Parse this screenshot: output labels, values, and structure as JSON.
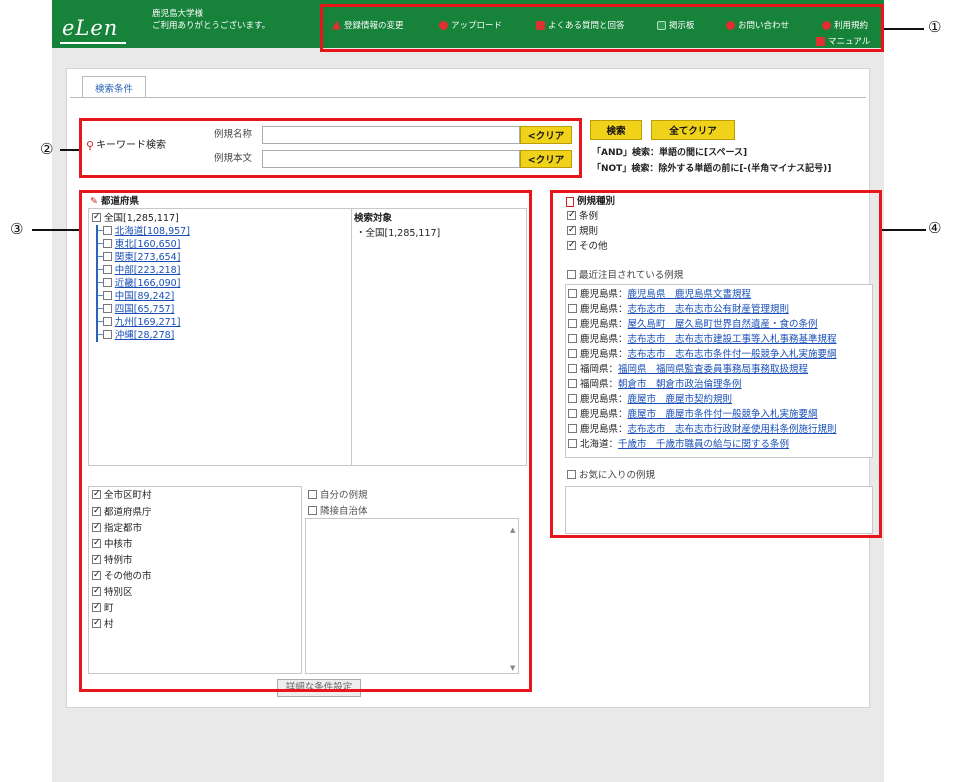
{
  "header": {
    "logo": "eLen",
    "greeting": "鹿児島大学様\nご利用ありがとうございます。",
    "nav": [
      {
        "label": "登録情報の変更",
        "icon": "warning-icon",
        "color": "#e03030"
      },
      {
        "label": "アップロード",
        "icon": "upload-icon",
        "color": "#e03030"
      },
      {
        "label": "よくある質問と回答",
        "icon": "faq-icon",
        "color": "#e03030"
      },
      {
        "label": "掲示板",
        "icon": "board-icon",
        "color": "#2f9a4f"
      },
      {
        "label": "お問い合わせ",
        "icon": "mail-icon",
        "color": "#e03030"
      },
      {
        "label": "利用規約",
        "icon": "terms-icon",
        "color": "#e03030"
      },
      {
        "label": "マニュアル",
        "icon": "manual-icon",
        "color": "#e03030"
      }
    ]
  },
  "tab": {
    "label": "検索条件"
  },
  "keyword": {
    "title": "キーワード検索",
    "name_label": "例規名称",
    "body_label": "例規本文",
    "clear1": "<クリア",
    "clear2": "<クリア",
    "name_value": "",
    "body_value": ""
  },
  "actions": {
    "search": "検索",
    "clear_all": "全てクリア",
    "hint_and": "「AND」検索：単語の間に[スペース]",
    "hint_not": "「NOT」検索：除外する単語の前に[-(半角マイナス記号)]"
  },
  "prefecture": {
    "title": "都道府県",
    "all": "全国[1,285,117]",
    "regions": [
      "北海道[108,957]",
      "東北[160,650]",
      "関東[273,654]",
      "中部[223,218]",
      "近畿[166,090]",
      "中国[89,242]",
      "四国[65,757]",
      "九州[169,271]",
      "沖縄[28,278]"
    ],
    "target_title": "検索対象",
    "target_item": "・全国[1,285,117]",
    "municipal_all": "全市区町村",
    "municipal": [
      "都道府県庁",
      "指定都市",
      "中核市",
      "特例市",
      "その他の市",
      "特別区",
      "町",
      "村"
    ],
    "own_rules": "自分の例規",
    "neighbor": "隣接自治体",
    "detail_button": "詳細な条件設定"
  },
  "types": {
    "title": "例規種別",
    "items": [
      "条例",
      "規則",
      "その他"
    ],
    "recent_title": "最近注目されている例規",
    "recent": [
      {
        "pref": "鹿児島県：",
        "name": "鹿児島県　鹿児島県文書規程"
      },
      {
        "pref": "鹿児島県：",
        "name": "志布志市　志布志市公有財産管理規則"
      },
      {
        "pref": "鹿児島県：",
        "name": "屋久島町　屋久島町世界自然遺産・食の条例"
      },
      {
        "pref": "鹿児島県：",
        "name": "志布志市　志布志市建設工事等入札事務基準規程"
      },
      {
        "pref": "鹿児島県：",
        "name": "志布志市　志布志市条件付一般競争入札実施要綱"
      },
      {
        "pref": "福岡県：",
        "name": "福岡県　福岡県監査委員事務局事務取扱規程"
      },
      {
        "pref": "福岡県：",
        "name": "朝倉市　朝倉市政治倫理条例"
      },
      {
        "pref": "鹿児島県：",
        "name": "鹿屋市　鹿屋市契約規則"
      },
      {
        "pref": "鹿児島県：",
        "name": "鹿屋市　鹿屋市条件付一般競争入札実施要綱"
      },
      {
        "pref": "鹿児島県：",
        "name": "志布志市　志布志市行政財産使用料条例施行規則"
      },
      {
        "pref": "北海道：",
        "name": "千歳市　千歳市職員の給与に関する条例"
      }
    ],
    "favorites_title": "お気に入りの例規"
  },
  "callouts": [
    "①",
    "②",
    "③",
    "④"
  ]
}
